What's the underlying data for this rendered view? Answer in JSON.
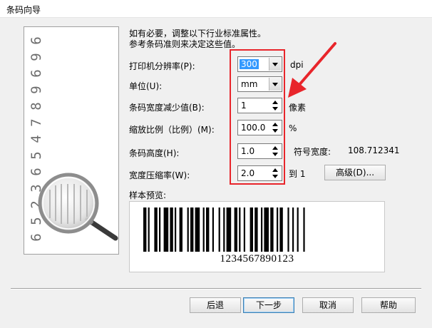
{
  "window": {
    "title": "条码向导"
  },
  "instructions": {
    "line1": "如有必要，调整以下行业标准属性。",
    "line2": "参考条码准则来决定这些值。"
  },
  "side_panel": {
    "digits": [
      "6",
      "5",
      "2",
      "3",
      "6",
      "5",
      "4",
      "7",
      "8",
      "9",
      "6",
      "9",
      "6"
    ]
  },
  "form": {
    "print_resolution": {
      "label": "打印机分辨率(P):",
      "value": "300",
      "unit": "dpi"
    },
    "units": {
      "label": "单位(U):",
      "value": "mm"
    },
    "width_reduction": {
      "label": "条码宽度减少值(B):",
      "value": "1",
      "unit": "像素"
    },
    "scale": {
      "label": "缩放比例（比例）(M):",
      "value": "100.0",
      "unit": "%"
    },
    "bar_height": {
      "label": "条码高度(H):",
      "value": "1.0"
    },
    "symbol_width": {
      "label": "符号宽度:",
      "value": "108.712341"
    },
    "width_ratio": {
      "label": "宽度压缩率(W):",
      "value": "2.0",
      "suffix": "到 1"
    },
    "advanced_button": "高级(D)..."
  },
  "preview": {
    "label": "样本预览:",
    "barcode_text": "1234567890123"
  },
  "footer": {
    "back": "后退",
    "next": "下一步",
    "cancel": "取消",
    "help": "帮助"
  },
  "colors": {
    "annotation_red": "#e8252b",
    "selection_blue": "#3399ff"
  }
}
